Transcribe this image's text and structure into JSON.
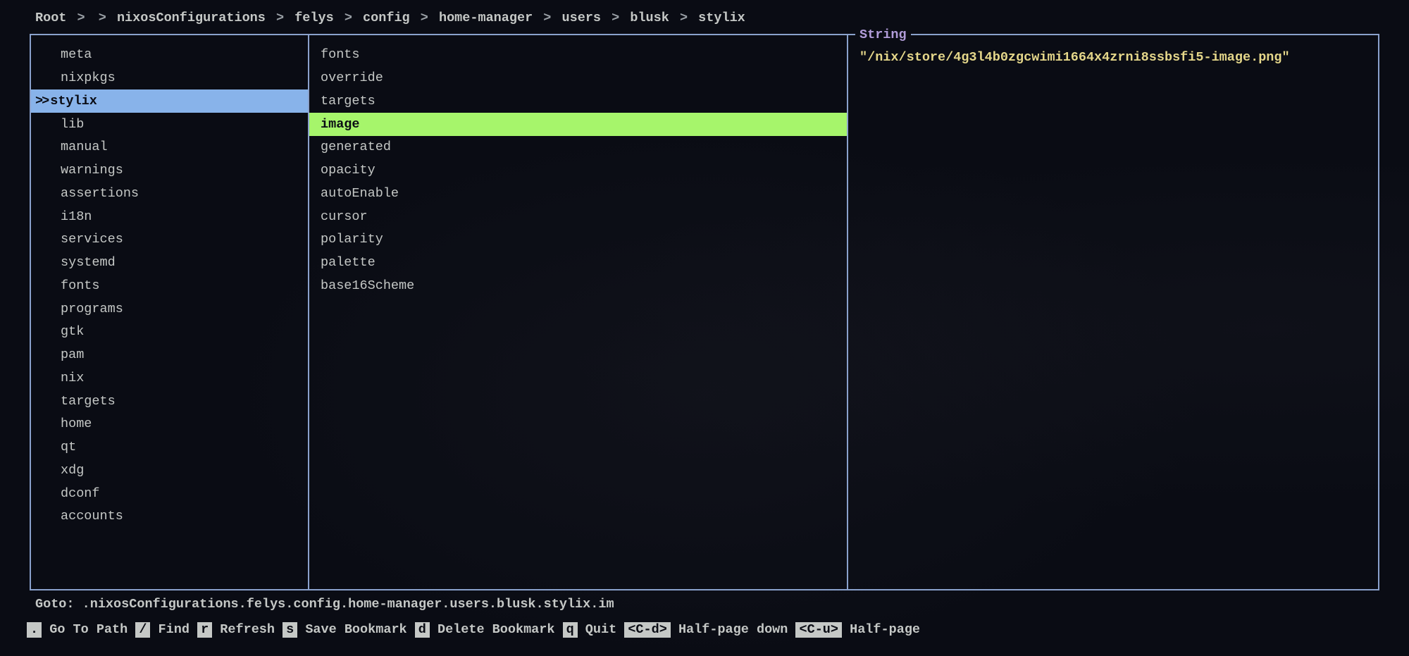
{
  "breadcrumb": {
    "items": [
      "Root",
      "",
      "nixosConfigurations",
      "felys",
      "config",
      "home-manager",
      "users",
      "blusk",
      "stylix"
    ],
    "separator": ">"
  },
  "columns": {
    "parent": {
      "items": [
        {
          "label": "meta",
          "selected": false
        },
        {
          "label": "nixpkgs",
          "selected": false
        },
        {
          "label": "stylix",
          "selected": true
        },
        {
          "label": "lib",
          "selected": false
        },
        {
          "label": "manual",
          "selected": false
        },
        {
          "label": "warnings",
          "selected": false
        },
        {
          "label": "assertions",
          "selected": false
        },
        {
          "label": "i18n",
          "selected": false
        },
        {
          "label": "services",
          "selected": false
        },
        {
          "label": "systemd",
          "selected": false
        },
        {
          "label": "fonts",
          "selected": false
        },
        {
          "label": "programs",
          "selected": false
        },
        {
          "label": "gtk",
          "selected": false
        },
        {
          "label": "pam",
          "selected": false
        },
        {
          "label": "nix",
          "selected": false
        },
        {
          "label": "targets",
          "selected": false
        },
        {
          "label": "home",
          "selected": false
        },
        {
          "label": "qt",
          "selected": false
        },
        {
          "label": "xdg",
          "selected": false
        },
        {
          "label": "dconf",
          "selected": false
        },
        {
          "label": "accounts",
          "selected": false
        }
      ]
    },
    "current": {
      "items": [
        {
          "label": "fonts",
          "selected": false
        },
        {
          "label": "override",
          "selected": false
        },
        {
          "label": "targets",
          "selected": false
        },
        {
          "label": "image",
          "selected": true
        },
        {
          "label": "generated",
          "selected": false
        },
        {
          "label": "opacity",
          "selected": false
        },
        {
          "label": "autoEnable",
          "selected": false
        },
        {
          "label": "cursor",
          "selected": false
        },
        {
          "label": "polarity",
          "selected": false
        },
        {
          "label": "palette",
          "selected": false
        },
        {
          "label": "base16Scheme",
          "selected": false
        }
      ]
    },
    "preview": {
      "type": "String",
      "value": "\"/nix/store/4g3l4b0zgcwimi1664x4zrni8ssbsfi5-image.png\""
    }
  },
  "goto": {
    "prefix": "Goto: ",
    "path": ".nixosConfigurations.felys.config.home-manager.users.blusk.stylix.im"
  },
  "help": {
    "items": [
      {
        "key": ".",
        "label": "Go To Path"
      },
      {
        "key": "/",
        "label": "Find"
      },
      {
        "key": "r",
        "label": "Refresh"
      },
      {
        "key": "s",
        "label": "Save Bookmark"
      },
      {
        "key": "d",
        "label": "Delete Bookmark"
      },
      {
        "key": "q",
        "label": "Quit"
      },
      {
        "key": "<C-d>",
        "label": "Half-page down"
      },
      {
        "key": "<C-u>",
        "label": "Half-page"
      }
    ]
  }
}
